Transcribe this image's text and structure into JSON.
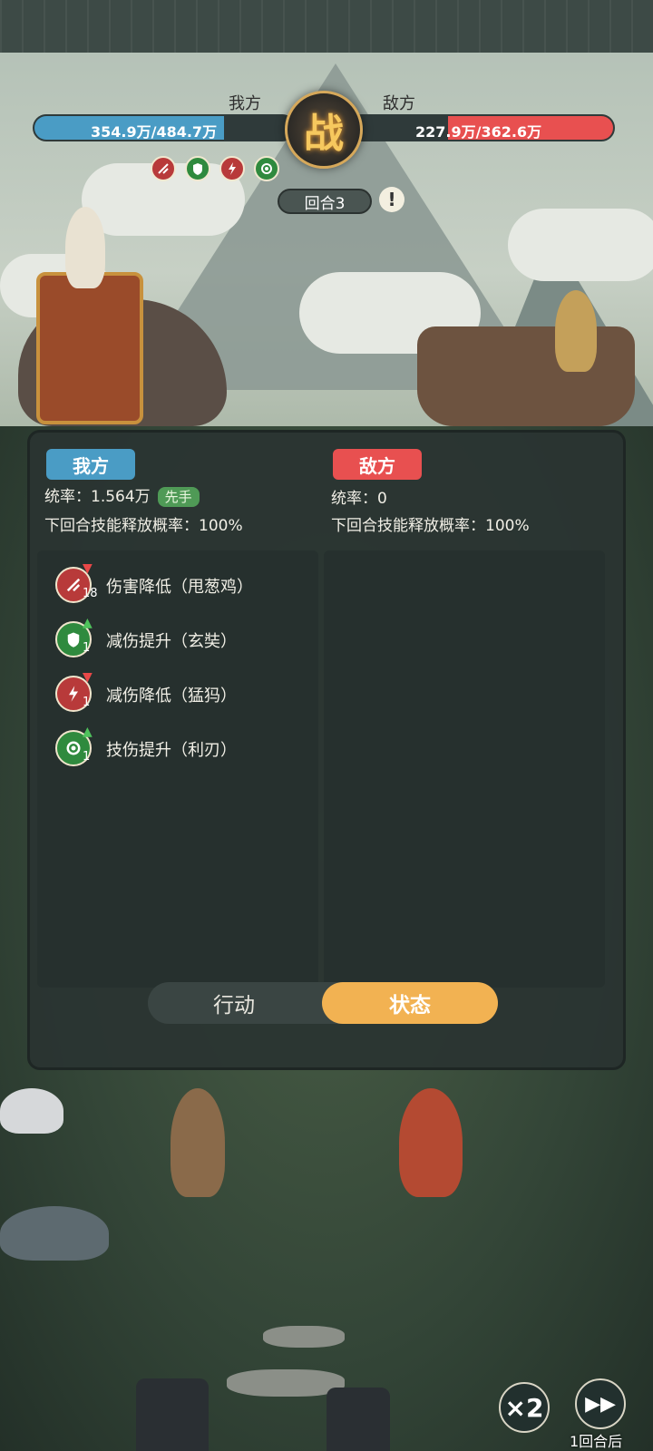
{
  "hud": {
    "our_label": "我方",
    "enemy_label": "敌方",
    "our_hp": "354.9万/484.7万",
    "enemy_hp": "227.9万/362.6万",
    "our_hp_fraction": 0.732,
    "enemy_hp_fraction": 0.628,
    "battle_glyph": "战",
    "round_label": "回合3",
    "info_glyph": "!"
  },
  "panel": {
    "our": {
      "tag": "我方",
      "command": "统率：1.564万",
      "first_badge": "先手",
      "skill_rate": "下回合技能释放概率：100%",
      "effects": [
        {
          "label": "伤害降低（甩葱鸡）",
          "count": "18",
          "icon": "damage-down-icon",
          "trend": "down"
        },
        {
          "label": "减伤提升（玄奘）",
          "count": "1",
          "icon": "shield-up-icon",
          "trend": "up"
        },
        {
          "label": "减伤降低（猛犸）",
          "count": "1",
          "icon": "lightning-down-icon",
          "trend": "down"
        },
        {
          "label": "技伤提升（利刃）",
          "count": "1",
          "icon": "swirl-up-icon",
          "trend": "up"
        }
      ]
    },
    "enemy": {
      "tag": "敌方",
      "command": "统率：0",
      "skill_rate": "下回合技能释放概率：100%"
    },
    "tabs": {
      "action": "行动",
      "status": "状态"
    }
  },
  "controls": {
    "speed": "×2",
    "skip_glyph": "▶▶",
    "after_round": "1回合后"
  },
  "colors": {
    "our_blue": "#4a9cc5",
    "enemy_red": "#e85050",
    "tab_active": "#f2b252",
    "up_green": "#3fa54b",
    "down_red": "#d83a3a"
  }
}
